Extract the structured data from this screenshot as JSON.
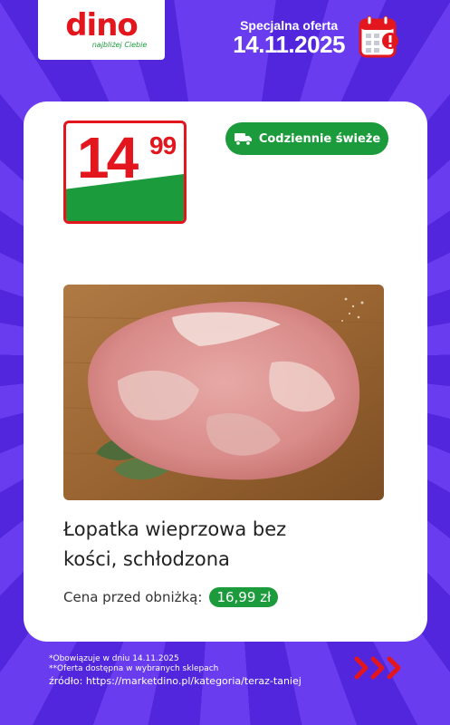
{
  "header": {
    "brand": "dino",
    "tagline": "najbliżej Ciebie",
    "offer_label": "Specjalna oferta",
    "offer_date": "14.11.2025"
  },
  "product": {
    "price_whole": "14",
    "price_cents": "99",
    "badge": "Codziennie świeże",
    "name_line1": "Łopatka wieprzowa bez",
    "name_line2": "kości, schłodzona",
    "prev_label": "Cena przed obniżką:",
    "prev_price": "16,99 zł"
  },
  "footer": {
    "note1": "*Obowiązuje w dniu 14.11.2025",
    "note2": "**Oferta dostępna w wybranych sklepach",
    "source": "źródło: https://marketdino.pl/kategoria/teraz-taniej"
  },
  "colors": {
    "background": "#5b2de6",
    "brand_red": "#e3161e",
    "brand_green": "#1c9b3c"
  }
}
